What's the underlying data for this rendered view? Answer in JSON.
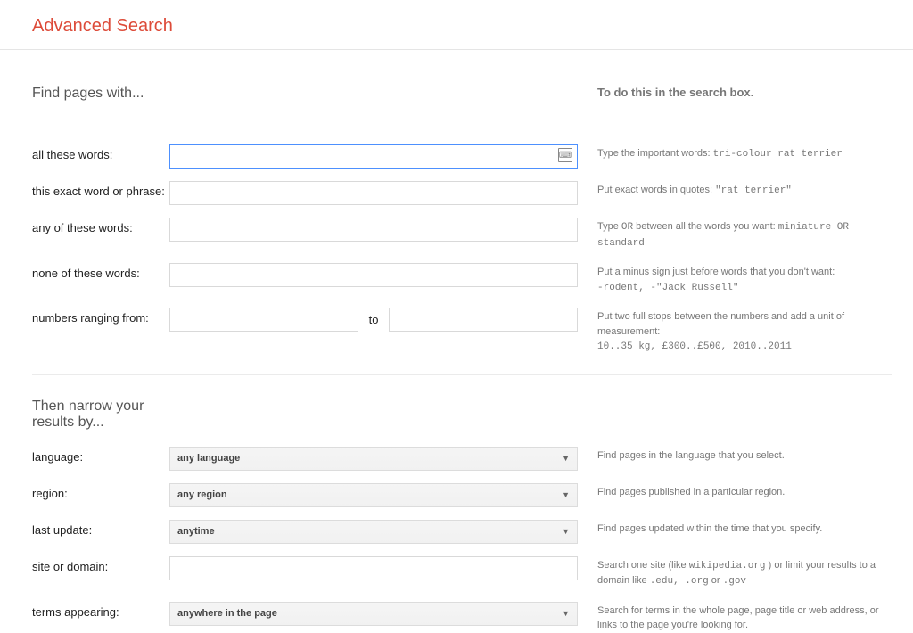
{
  "header": {
    "title": "Advanced Search"
  },
  "sections": {
    "find": {
      "title": "Find pages with...",
      "hint_head": "To do this in the search box.",
      "rows": {
        "all_words": {
          "label": "all these words:",
          "hint_pre": "Type the important words:",
          "hint_mono": "tri-colour rat terrier"
        },
        "exact": {
          "label": "this exact word or phrase:",
          "hint_pre": "Put exact words in quotes:",
          "hint_mono": "\"rat terrier\""
        },
        "any": {
          "label": "any of these words:",
          "hint_pre": "Type ",
          "hint_or": "OR",
          "hint_post": " between all the words you want:",
          "hint_mono": "miniature OR standard"
        },
        "none": {
          "label": "none of these words:",
          "hint_pre": "Put a minus sign just before words that you don't want:",
          "hint_mono": "-rodent, -\"Jack Russell\""
        },
        "range": {
          "label": "numbers ranging from:",
          "to": "to",
          "hint_pre": "Put two full stops between the numbers and add a unit of measurement:",
          "hint_mono": "10..35 kg, £300..£500, 2010..2011"
        }
      }
    },
    "narrow": {
      "title": "Then narrow your results by...",
      "rows": {
        "language": {
          "label": "language:",
          "value": "any language",
          "hint": "Find pages in the language that you select."
        },
        "region": {
          "label": "region:",
          "value": "any region",
          "hint": "Find pages published in a particular region."
        },
        "last_update": {
          "label": "last update:",
          "value": "anytime",
          "hint": "Find pages updated within the time that you specify."
        },
        "site": {
          "label": "site or domain:",
          "hint_pre": "Search one site (like ",
          "hint_mono1": "wikipedia.org",
          "hint_mid": " ) or limit your results to a domain like ",
          "hint_mono2": ".edu, .org",
          "hint_or": " or ",
          "hint_mono3": ".gov"
        },
        "terms": {
          "label": "terms appearing:",
          "value": "anywhere in the page",
          "hint": "Search for terms in the whole page, page title or web address, or links to the page you're looking for."
        }
      }
    }
  }
}
